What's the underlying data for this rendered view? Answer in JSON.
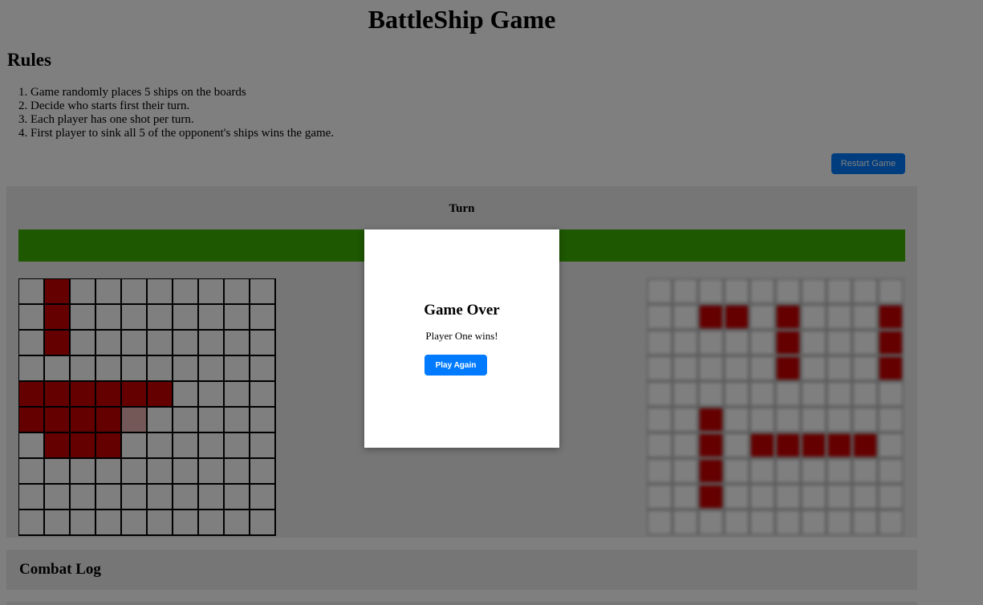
{
  "title": "BattleShip Game",
  "rules": {
    "heading": "Rules",
    "items": [
      "Game randomly places 5 ships on the boards",
      "Decide who starts first their turn.",
      "Each player has one shot per turn.",
      "First player to sink all 5 of the opponent's ships wins the game."
    ]
  },
  "controls": {
    "restart_label": "Restart Game"
  },
  "turn": {
    "label": "Turn",
    "bar_color": "#3cb100"
  },
  "boards": {
    "left": {
      "rows": [
        "0100000000",
        "0100000000",
        "0100000000",
        "0000000000",
        "1111110000",
        "1111200000",
        "0111000000",
        "0000000000",
        "0000000000",
        "0000000000"
      ]
    },
    "right": {
      "rows": [
        "0000000000",
        "0011010001",
        "0000010001",
        "0000010001",
        "0000000000",
        "0010000000",
        "0010111110",
        "0010000000",
        "0010000000",
        "0000000000"
      ]
    },
    "legend": {
      "ship_color": "#c90000",
      "hit_color": "#e9b0b0",
      "water_color": "#ffffff"
    }
  },
  "combat_log": {
    "heading": "Combat Log"
  },
  "modal": {
    "heading": "Game Over",
    "message": "Player One wins!",
    "button_label": "Play Again"
  }
}
